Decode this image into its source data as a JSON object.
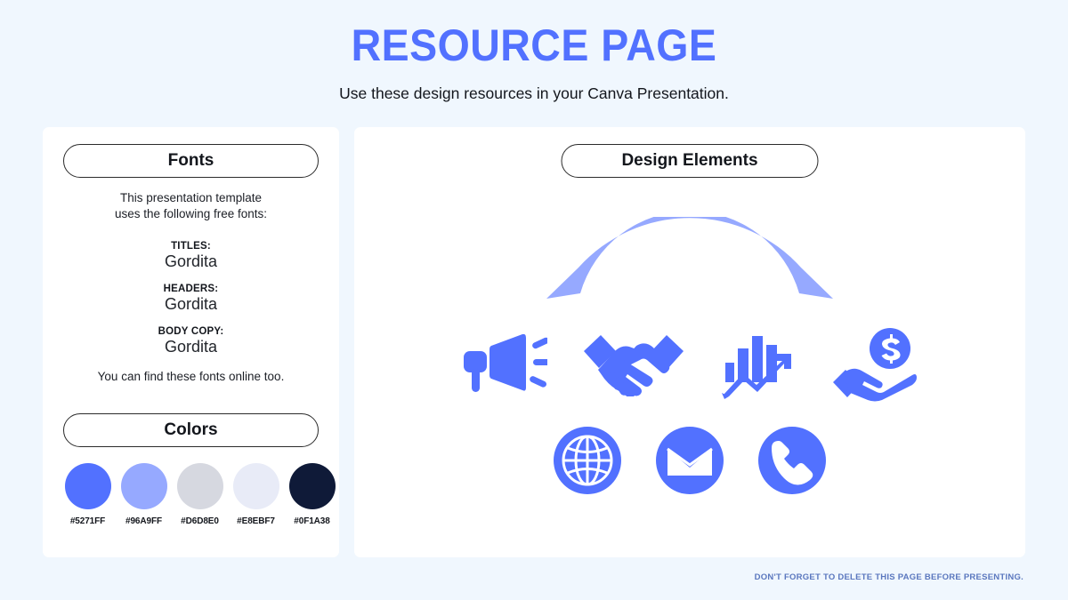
{
  "page": {
    "background_color": "#F0F7FE",
    "accent_color": "#5271FF",
    "title": "RESOURCE PAGE",
    "subtitle": "Use these design resources in your Canva Presentation.",
    "footer_note": "DON'T FORGET TO DELETE THIS PAGE BEFORE PRESENTING."
  },
  "fonts_panel": {
    "heading": "Fonts",
    "intro_line_1": "This presentation template",
    "intro_line_2": "uses the following free fonts:",
    "groups": [
      {
        "label": "TITLES:",
        "font": "Gordita"
      },
      {
        "label": "HEADERS:",
        "font": "Gordita"
      },
      {
        "label": "BODY COPY:",
        "font": "Gordita"
      }
    ],
    "outro": "You can find these fonts online too."
  },
  "colors_panel": {
    "heading": "Colors",
    "swatches": [
      {
        "hex": "#5271FF"
      },
      {
        "hex": "#96A9FF"
      },
      {
        "hex": "#D6D8E0"
      },
      {
        "hex": "#E8EBF7"
      },
      {
        "hex": "#0F1A38"
      }
    ]
  },
  "elements_panel": {
    "heading": "Design Elements",
    "arc": {
      "name": "decorative-arc",
      "color": "#96A9FF"
    },
    "icon_color": "#5271FF",
    "icons_row_1": [
      {
        "name": "megaphone-icon"
      },
      {
        "name": "handshake-icon"
      },
      {
        "name": "growth-chart-icon"
      },
      {
        "name": "hand-with-money-icon"
      }
    ],
    "icons_row_2": [
      {
        "name": "globe-icon"
      },
      {
        "name": "envelope-icon"
      },
      {
        "name": "phone-icon"
      }
    ]
  }
}
